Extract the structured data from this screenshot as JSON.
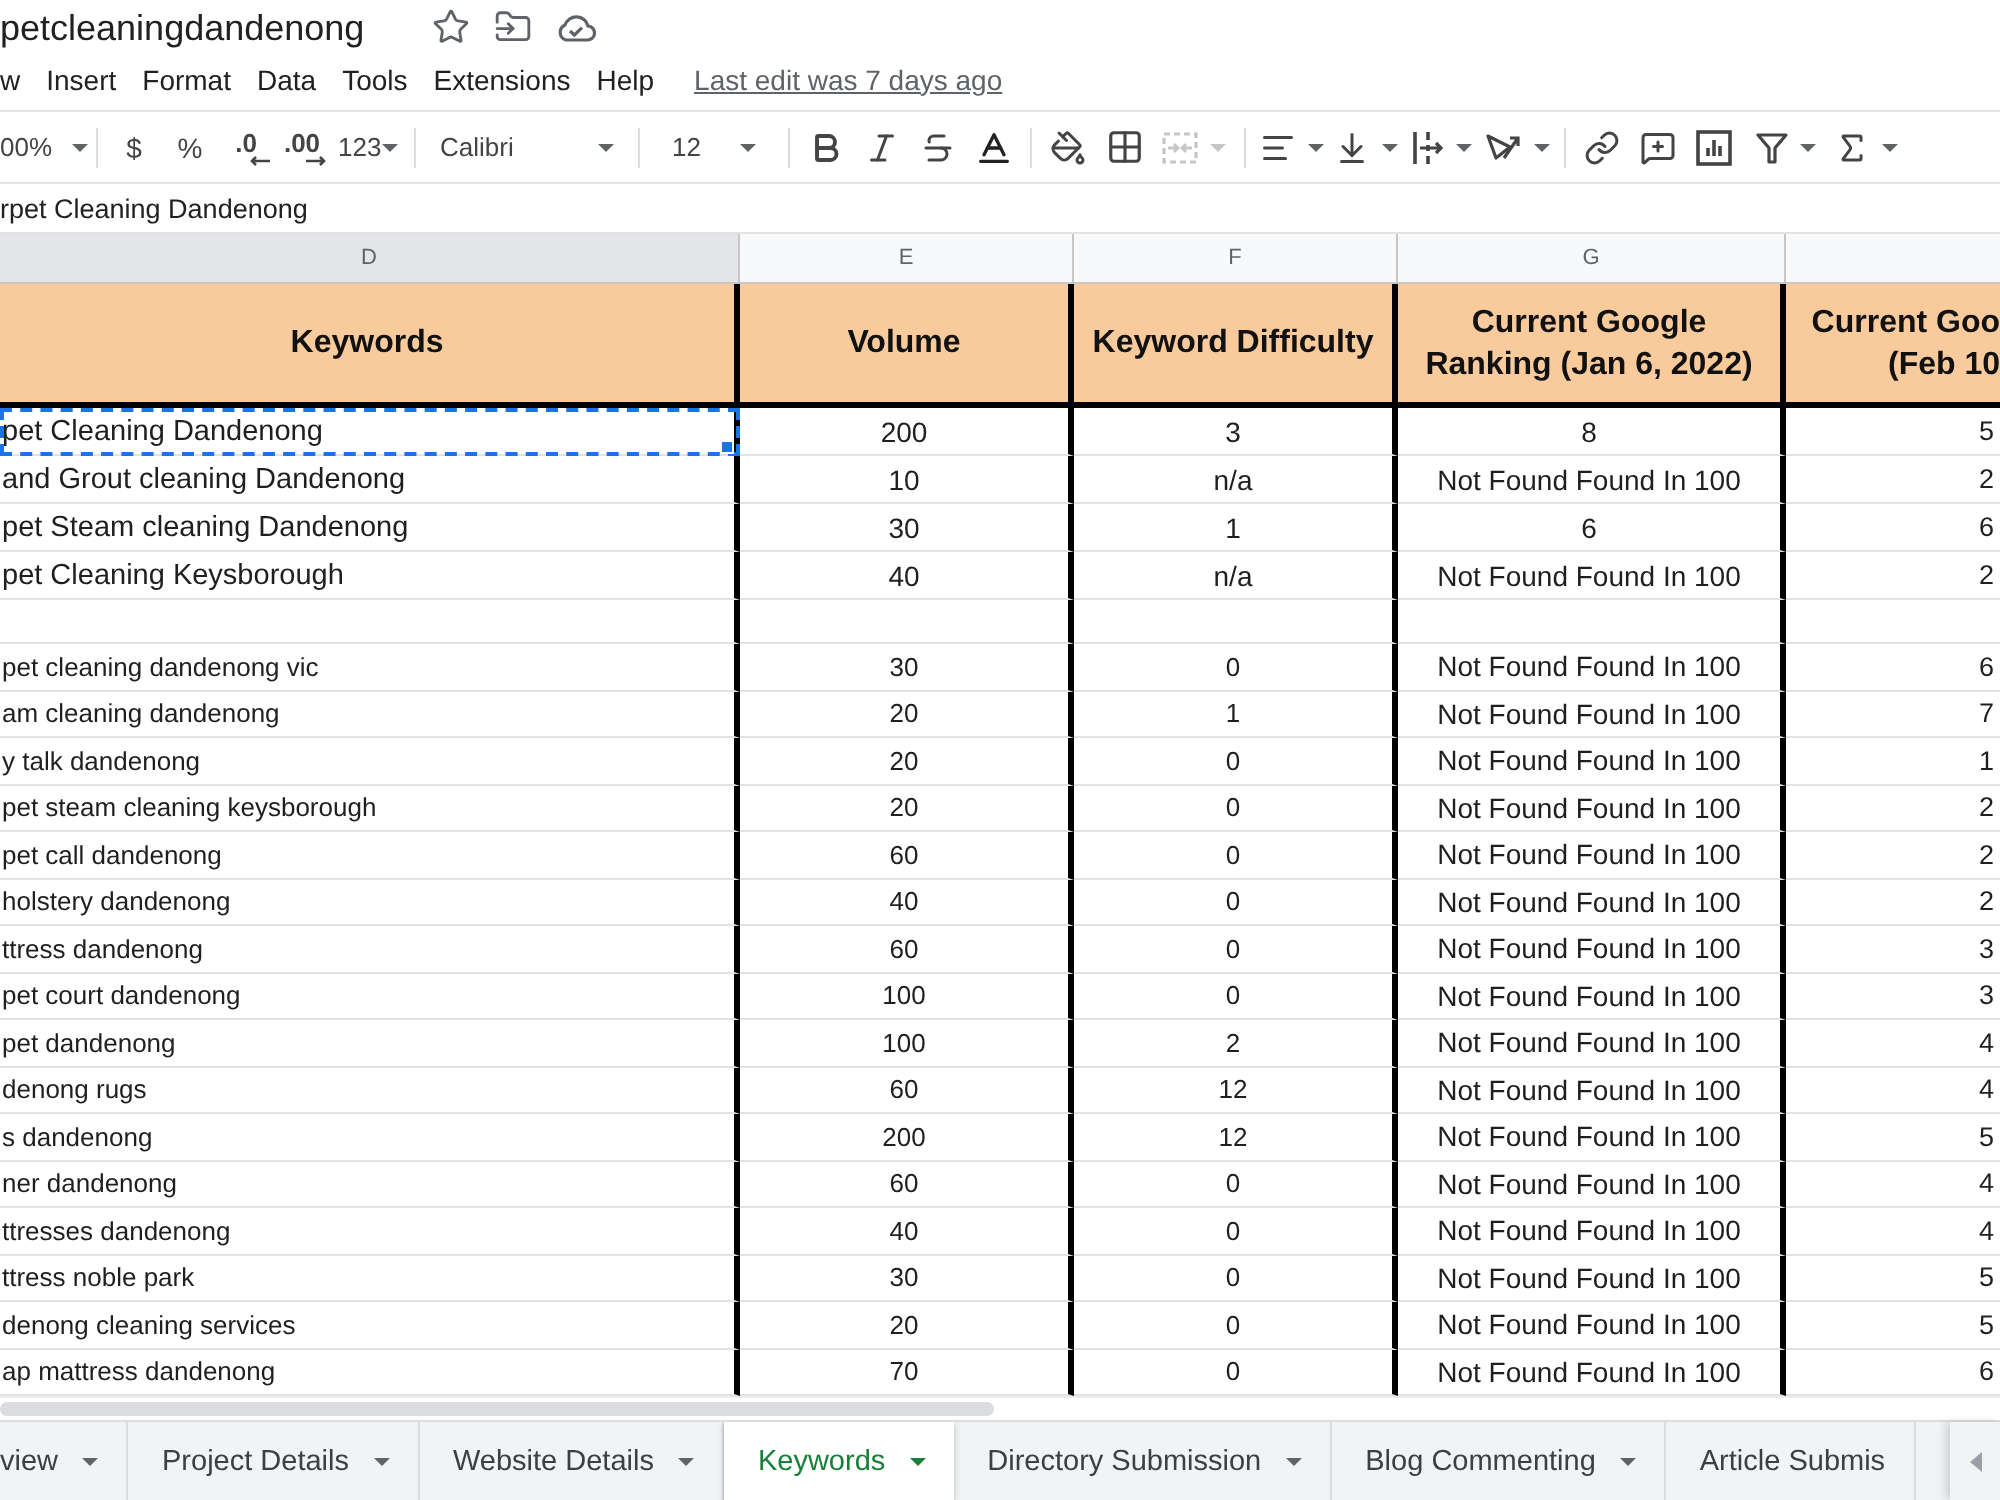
{
  "document": {
    "title": "petcleaningdandenong"
  },
  "menu": {
    "items": [
      "w",
      "Insert",
      "Format",
      "Data",
      "Tools",
      "Extensions",
      "Help"
    ],
    "last_edit": "Last edit was 7 days ago"
  },
  "toolbar": {
    "zoom": "00%",
    "currency": "$",
    "percent": "%",
    "decrease_decimals": ".0",
    "increase_decimals": ".00",
    "number_format": "123",
    "font": "Calibri",
    "font_size": "12",
    "merge": {
      "disabled": true
    }
  },
  "formula_bar": {
    "value": "rpet Cleaning Dandenong"
  },
  "sheet": {
    "columns": [
      {
        "letter": "D",
        "selected": true,
        "header": [
          "Keywords"
        ]
      },
      {
        "letter": "E",
        "selected": false,
        "header": [
          "Volume"
        ]
      },
      {
        "letter": "F",
        "selected": false,
        "header": [
          "Keyword Difficulty"
        ]
      },
      {
        "letter": "G",
        "selected": false,
        "header": [
          "Current Google",
          "Ranking (Jan 6, 2022)"
        ]
      },
      {
        "selected": false,
        "header": [
          "Current Goo",
          "(Feb 10"
        ]
      }
    ],
    "rows": [
      {
        "kind": "main",
        "selected": true,
        "cells": [
          "pet Cleaning Dandenong",
          "200",
          "3",
          "8",
          "5"
        ]
      },
      {
        "kind": "main",
        "selected": false,
        "cells": [
          "and Grout cleaning Dandenong",
          "10",
          "n/a",
          "Not Found Found In 100",
          "2"
        ]
      },
      {
        "kind": "main",
        "selected": false,
        "cells": [
          "pet Steam cleaning Dandenong",
          "30",
          "1",
          "6",
          "6"
        ]
      },
      {
        "kind": "main",
        "selected": false,
        "cells": [
          "pet Cleaning Keysborough",
          "40",
          "n/a",
          "Not Found Found In 100",
          "2"
        ]
      },
      {
        "kind": "spacer",
        "selected": false
      },
      {
        "kind": "related",
        "selected": false,
        "cells": [
          "pet cleaning dandenong vic",
          "30",
          "0",
          "Not Found Found In 100",
          "6"
        ]
      },
      {
        "kind": "related",
        "selected": false,
        "cells": [
          "am cleaning dandenong",
          "20",
          "1",
          "Not Found Found In 100",
          "7"
        ]
      },
      {
        "kind": "related",
        "selected": false,
        "cells": [
          "y talk dandenong",
          "20",
          "0",
          "Not Found Found In 100",
          "1"
        ]
      },
      {
        "kind": "related",
        "selected": false,
        "cells": [
          "pet steam cleaning keysborough",
          "20",
          "0",
          "Not Found Found In 100",
          "2"
        ]
      },
      {
        "kind": "related",
        "selected": false,
        "cells": [
          "pet call dandenong",
          "60",
          "0",
          "Not Found Found In 100",
          "2"
        ]
      },
      {
        "kind": "related",
        "selected": false,
        "cells": [
          "holstery dandenong",
          "40",
          "0",
          "Not Found Found In 100",
          "2"
        ]
      },
      {
        "kind": "related",
        "selected": false,
        "cells": [
          "ttress dandenong",
          "60",
          "0",
          "Not Found Found In 100",
          "3"
        ]
      },
      {
        "kind": "related",
        "selected": false,
        "cells": [
          "pet court dandenong",
          "100",
          "0",
          "Not Found Found In 100",
          "3"
        ]
      },
      {
        "kind": "related",
        "selected": false,
        "cells": [
          "pet dandenong",
          "100",
          "2",
          "Not Found Found In 100",
          "4"
        ]
      },
      {
        "kind": "related",
        "selected": false,
        "cells": [
          "denong rugs",
          "60",
          "12",
          "Not Found Found In 100",
          "4"
        ]
      },
      {
        "kind": "related",
        "selected": false,
        "cells": [
          "s dandenong",
          "200",
          "12",
          "Not Found Found In 100",
          "5"
        ]
      },
      {
        "kind": "related",
        "selected": false,
        "cells": [
          "ner dandenong",
          "60",
          "0",
          "Not Found Found In 100",
          "4"
        ]
      },
      {
        "kind": "related",
        "selected": false,
        "cells": [
          "ttresses dandenong",
          "40",
          "0",
          "Not Found Found In 100",
          "4"
        ]
      },
      {
        "kind": "related",
        "selected": false,
        "cells": [
          "ttress noble park",
          "30",
          "0",
          "Not Found Found In 100",
          "5"
        ]
      },
      {
        "kind": "related",
        "selected": false,
        "cells": [
          "denong cleaning services",
          "20",
          "0",
          "Not Found Found In 100",
          "5"
        ]
      },
      {
        "kind": "related",
        "selected": false,
        "cells": [
          "ap mattress dandenong",
          "70",
          "0",
          "Not Found Found In 100",
          "6"
        ]
      }
    ]
  },
  "tabs": [
    {
      "label": "view",
      "selected": false,
      "dropdown": true
    },
    {
      "label": "Project Details",
      "selected": false,
      "dropdown": true
    },
    {
      "label": "Website Details",
      "selected": false,
      "dropdown": true
    },
    {
      "label": "Keywords",
      "selected": true,
      "dropdown": true
    },
    {
      "label": "Directory Submission",
      "selected": false,
      "dropdown": true
    },
    {
      "label": "Blog Commenting",
      "selected": false,
      "dropdown": true
    },
    {
      "label": "Article Submis",
      "selected": false,
      "dropdown": false
    }
  ]
}
